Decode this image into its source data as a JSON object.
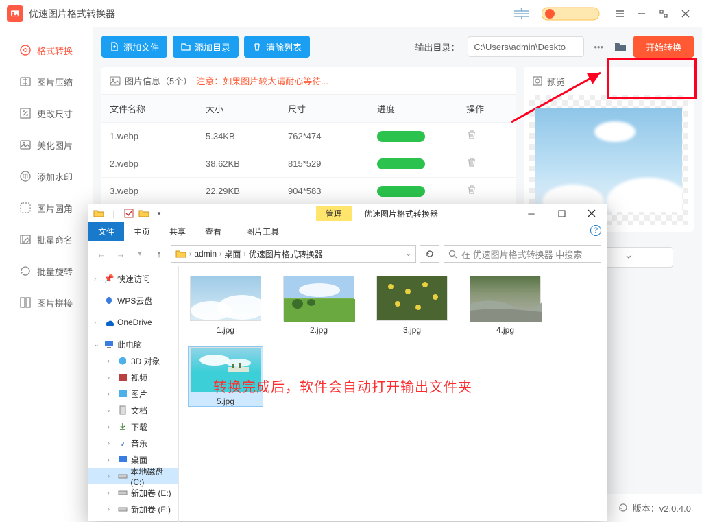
{
  "app": {
    "title": "优速图片格式转换器"
  },
  "sidebar": {
    "items": [
      {
        "label": "格式转换"
      },
      {
        "label": "图片压缩"
      },
      {
        "label": "更改尺寸"
      },
      {
        "label": "美化图片"
      },
      {
        "label": "添加水印"
      },
      {
        "label": "图片圆角"
      },
      {
        "label": "批量命名"
      },
      {
        "label": "批量旋转"
      },
      {
        "label": "图片拼接"
      }
    ]
  },
  "toolbar": {
    "add_file": "添加文件",
    "add_dir": "添加目录",
    "clear": "清除列表",
    "out_label": "输出目录：",
    "out_path": "C:\\Users\\admin\\Deskto",
    "start": "开始转换"
  },
  "info": {
    "prefix": "图片信息（5个）",
    "warn": "注意：如果图片较大请耐心等待..."
  },
  "table": {
    "headers": {
      "name": "文件名称",
      "size": "大小",
      "dim": "尺寸",
      "prog": "进度",
      "op": "操作"
    },
    "rows": [
      {
        "name": "1.webp",
        "size": "5.34KB",
        "dim": "762*474"
      },
      {
        "name": "2.webp",
        "size": "38.62KB",
        "dim": "815*529"
      },
      {
        "name": "3.webp",
        "size": "22.29KB",
        "dim": "904*583"
      }
    ]
  },
  "preview": {
    "label": "预览"
  },
  "status": {
    "version": "版本：v2.0.4.0"
  },
  "explorer": {
    "ribbon": {
      "manage": "管理",
      "title": "优速图片格式转换器",
      "file": "文件",
      "home": "主页",
      "share": "共享",
      "view": "查看",
      "tools": "图片工具"
    },
    "breadcrumb": [
      "admin",
      "桌面",
      "优速图片格式转换器"
    ],
    "search_ph": "在 优速图片格式转换器 中搜索",
    "tree": {
      "quick": "快速访问",
      "wps": "WPS云盘",
      "onedrive": "OneDrive",
      "pc": "此电脑",
      "objs": "3D 对象",
      "video": "视频",
      "pic": "图片",
      "doc": "文档",
      "dl": "下载",
      "music": "音乐",
      "desk": "桌面",
      "cdrive": "本地磁盘 (C:)",
      "edrive": "新加卷 (E:)",
      "fdrive": "新加卷 (F:)"
    },
    "files": [
      {
        "name": "1.jpg"
      },
      {
        "name": "2.jpg"
      },
      {
        "name": "3.jpg"
      },
      {
        "name": "4.jpg"
      },
      {
        "name": "5.jpg"
      }
    ],
    "annotation": "转换完成后，软件会自动打开输出文件夹"
  }
}
